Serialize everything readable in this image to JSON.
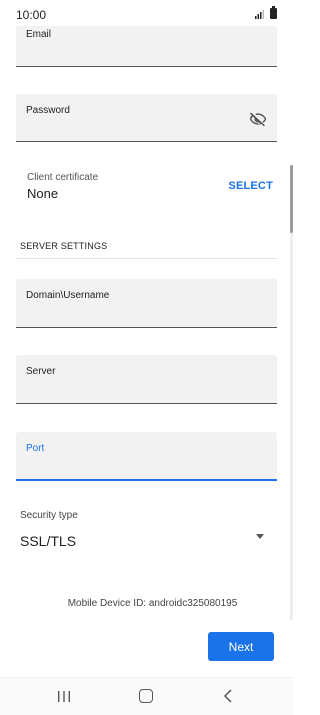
{
  "status_bar": {
    "time": "10:00"
  },
  "form": {
    "email_label": "Email",
    "password_label": "Password",
    "client_certificate": {
      "label": "Client certificate",
      "value": "None",
      "action": "SELECT"
    },
    "server_settings_title": "SERVER SETTINGS",
    "domain_username_label": "Domain\\Username",
    "server_label": "Server",
    "port_label": "Port",
    "security_type": {
      "label": "Security type",
      "value": "SSL/TLS"
    }
  },
  "footer": {
    "device_id": "Mobile Device ID: androidc325080195",
    "next_label": "Next"
  },
  "icons": {
    "password_toggle": "eye-off-icon",
    "dropdown": "dropdown-arrow-icon",
    "nav_recent": "recent-apps-icon",
    "nav_home": "home-icon",
    "nav_back": "back-icon"
  },
  "colors": {
    "accent": "#1a73e8",
    "field_background": "#f2f2f2"
  }
}
